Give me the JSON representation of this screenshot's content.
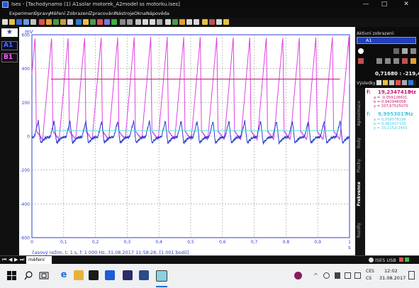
{
  "window": {
    "title": "Ises - [Tachodynamo (1) A1solar motorek_A2model ss motorku.ises]",
    "controls": {
      "minimize": "—",
      "maximize": "□",
      "close": "✕"
    }
  },
  "menu": [
    "Experiment",
    "Úpravy",
    "Měření",
    "Zobrazení",
    "Zpracování",
    "Nástroje",
    "Okna",
    "Nápověda"
  ],
  "left_panel": {
    "star": "★",
    "a1": "A1",
    "b1": "B1"
  },
  "plot": {
    "y_unit": "mV",
    "y_ticks": [
      "600",
      "400",
      "200",
      "0",
      "-200",
      "-400",
      "-600"
    ],
    "x_ticks": [
      "0",
      "0,1",
      "0,2",
      "0,3",
      "0,4",
      "0,5",
      "0,6",
      "0,7",
      "0,8",
      "0,9",
      "1"
    ],
    "x_unit": "s",
    "info": "časový režim, t: 1 s, f: 1 000 Hz, 31.08.2017 11:58:28, [1 001 bodů]",
    "colors": {
      "magenta": "#e040e0",
      "blue": "#2d3fd0",
      "red": "#c21a6a",
      "cyan": "#48e0e0"
    }
  },
  "right_panel": {
    "header": "Aktivní zobrazení:",
    "selected": "A1",
    "coords": "0,71680 : -219,439",
    "results_label": "Výsledky:",
    "result1": {
      "f": "f:",
      "value": "19,2347418",
      "unit": "Hz",
      "lines": [
        "a = -0,059128631",
        "b = 0,942946058",
        "y = 337,67525070"
      ]
    },
    "result2": {
      "f": "f:",
      "value": "9,9953017",
      "unit": "Hz",
      "lines": [
        "a = 0,058078199",
        "b = 0,982437135",
        "y = 33,1152(2443"
      ]
    },
    "tabs": [
      "Rozdíly",
      "Frekvence",
      "Plochy",
      "Body",
      "Aproximace"
    ]
  },
  "statusbar": {
    "tab": "měření",
    "device": "ISES USB",
    "nav": [
      "⏮",
      "◀",
      "▶",
      "⏭"
    ]
  },
  "taskbar": {
    "lang1": "CES",
    "lang2": "CS",
    "time": "12:02",
    "date": "31.08.2017"
  }
}
